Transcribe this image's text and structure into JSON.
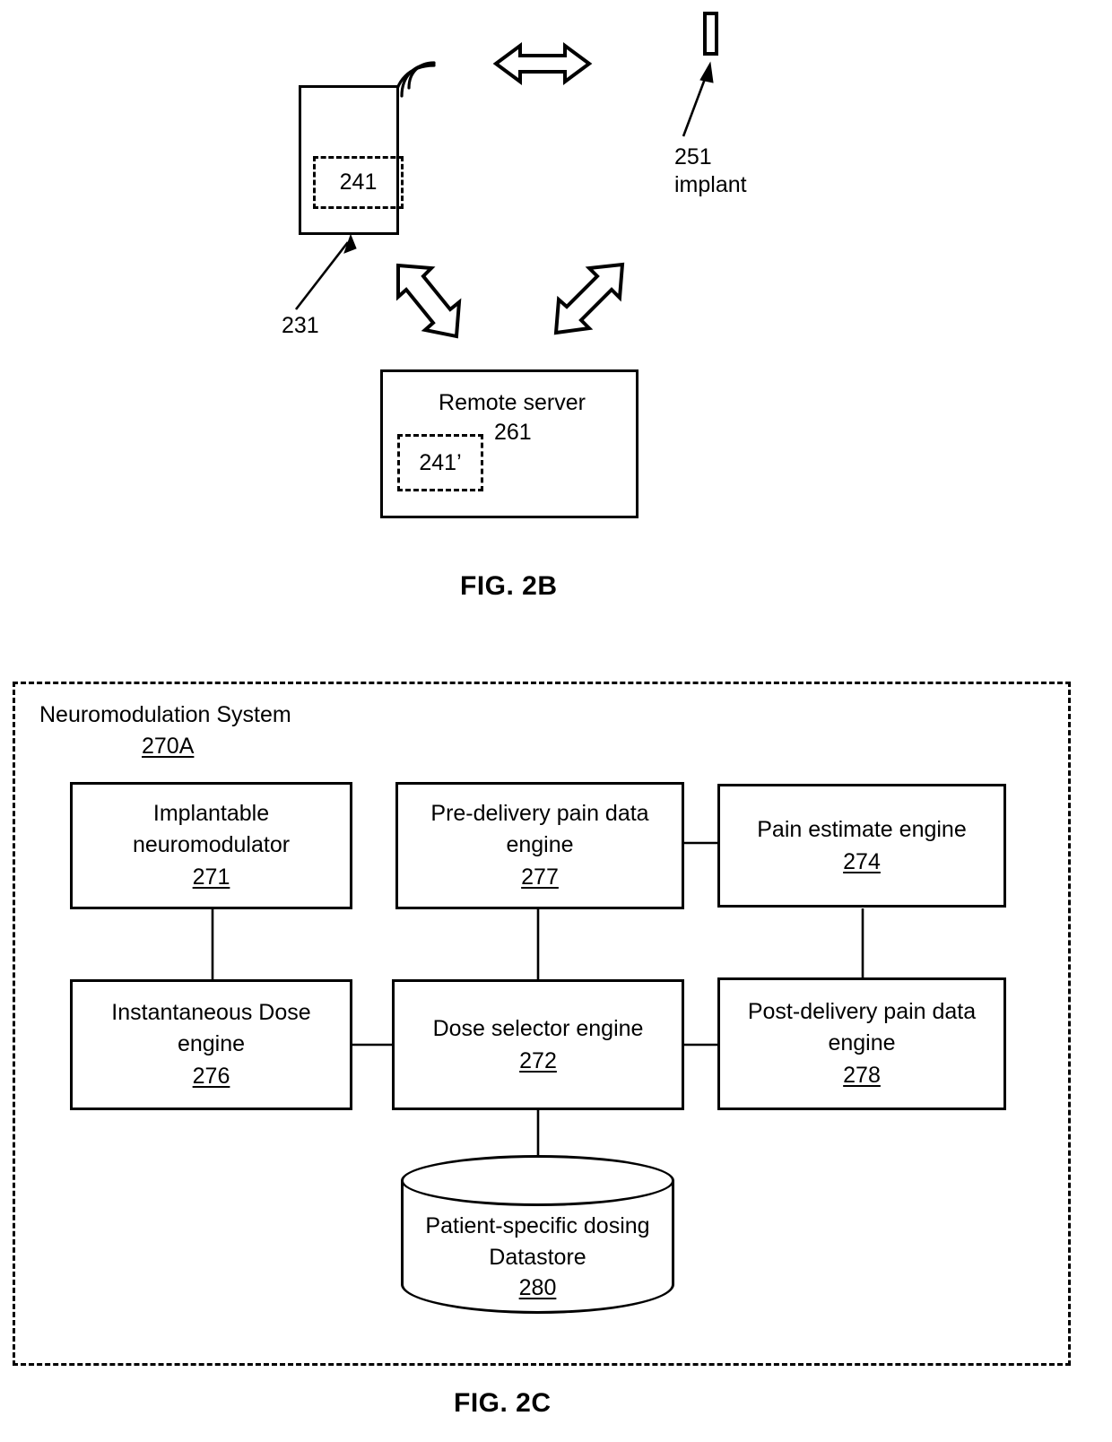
{
  "figure_2b": {
    "caption": "FIG. 2B",
    "device": {
      "name": "external-device",
      "inner_module_label": "241",
      "callout_number": "231",
      "wireless_icon": "wifi-waves-icon"
    },
    "implant": {
      "callout_number": "251",
      "callout_label": "implant"
    },
    "remote_server": {
      "title": "Remote server",
      "callout_number": "261",
      "inner_module_label": "241’"
    },
    "arrows": {
      "horizontal": "double-headed-arrow-icon",
      "diagonal_left": "double-headed-arrow-icon",
      "diagonal_right": "double-headed-arrow-icon"
    }
  },
  "figure_2c": {
    "caption": "FIG. 2C",
    "system": {
      "title": "Neuromodulation System",
      "number": "270A"
    },
    "blocks": [
      {
        "id": "implantable-neuromodulator",
        "line1": "Implantable",
        "line2": "neuromodulator",
        "number": "271"
      },
      {
        "id": "pre-delivery-pain-data-engine",
        "line1": "Pre-delivery pain data",
        "line2": "engine",
        "number": "277"
      },
      {
        "id": "pain-estimate-engine",
        "line1": "Pain estimate engine",
        "line2": "",
        "number": "274"
      },
      {
        "id": "instantaneous-dose-engine",
        "line1": "Instantaneous Dose",
        "line2": "engine",
        "number": "276"
      },
      {
        "id": "dose-selector-engine",
        "line1": "Dose selector engine",
        "line2": "",
        "number": "272"
      },
      {
        "id": "post-delivery-pain-data-engine",
        "line1": "Post-delivery pain data",
        "line2": "engine",
        "number": "278"
      }
    ],
    "datastore": {
      "id": "patient-specific-dosing-datastore",
      "line1": "Patient-specific dosing",
      "line2": "Datastore",
      "number": "280"
    }
  },
  "colors": {
    "ink": "#000000",
    "paper": "#ffffff"
  }
}
